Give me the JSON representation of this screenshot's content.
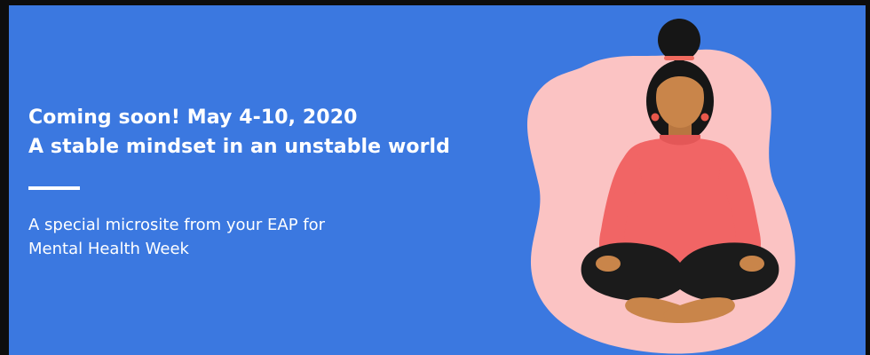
{
  "banner": {
    "headline_line1": "Coming soon! May 4-10, 2020",
    "headline_line2": "A stable mindset in an unstable world",
    "subtext_line1": "A special microsite from your EAP for",
    "subtext_line2": "Mental Health Week"
  },
  "colors": {
    "background": "#3b78e0",
    "text": "#ffffff",
    "blob": "#fbc3c3",
    "shirt": "#f16565",
    "skin": "#c9854a",
    "hair": "#161616",
    "pants": "#1b1b1b",
    "earrings": "#e8574a"
  },
  "illustration": {
    "subject": "meditating-woman-illustration"
  }
}
